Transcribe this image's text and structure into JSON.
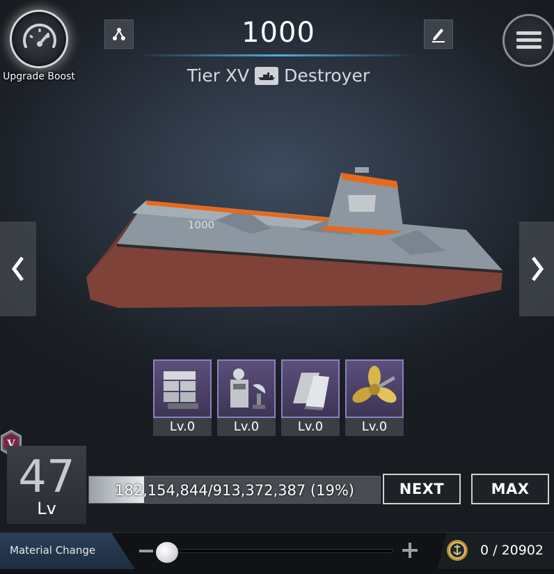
{
  "header": {
    "boost_label": "Upgrade Boost",
    "ship_name": "1000",
    "tier": "Tier XV",
    "ship_class": "Destroyer",
    "class_icon": "destroyer-icon"
  },
  "ship": {
    "hull_number": "1000",
    "colors": {
      "hull": "#6e3a33",
      "superstructure": "#8c97a1",
      "trim": "#e76a1c"
    }
  },
  "upgrade_parts": [
    {
      "icon": "missile-launcher-icon",
      "level": "Lv.0"
    },
    {
      "icon": "radar-icon",
      "level": "Lv.0"
    },
    {
      "icon": "armor-plate-icon",
      "level": "Lv.0"
    },
    {
      "icon": "propeller-icon",
      "level": "Lv.0"
    }
  ],
  "level_panel": {
    "rank_badge": "V",
    "level": "47",
    "level_label": "Lv",
    "xp_text": "182,154,844/913,372,387 (19%)",
    "xp_fraction": 0.19
  },
  "buttons": {
    "next_label": "NEXT",
    "max_label": "MAX"
  },
  "bottom": {
    "material_label": "Material Change",
    "slider_value": 0,
    "count_text": "0 / 20902"
  },
  "colors": {
    "accent_blue": "#4fb0d8",
    "part_frame": "#8f7fc0",
    "rank_badge": "#7a2540"
  }
}
